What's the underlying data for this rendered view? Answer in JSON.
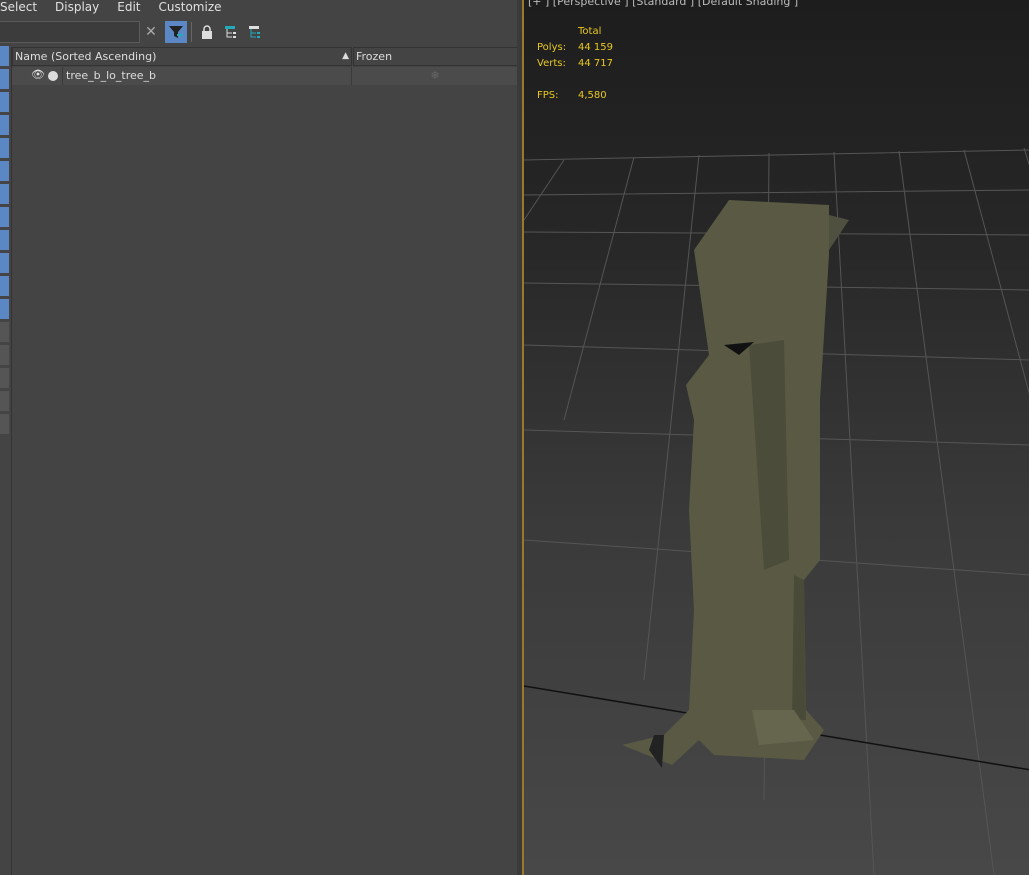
{
  "menu": [
    "Select",
    "Display",
    "Edit",
    "Customize"
  ],
  "search": {
    "value": "",
    "placeholder": ""
  },
  "toolbar": {
    "clear_icon": "close-icon",
    "filter_icon": "filter-icon",
    "lock_icon": "lock-icon",
    "hier1_icon": "hierarchy-icon",
    "hier2_icon": "hierarchy-icon"
  },
  "table": {
    "columns": [
      "Name (Sorted Ascending)",
      "Frozen"
    ],
    "sort_glyph": "▲",
    "rows": [
      {
        "name": "tree_b_lo_tree_b",
        "frozen_glyph": "❄"
      }
    ]
  },
  "viewport": {
    "label": "[+ ] [Perspective ] [Standard ] [Default Shading ]",
    "stats": {
      "header": "Total",
      "polys_label": "Polys:",
      "polys": "44 159",
      "verts_label": "Verts:",
      "verts": "44 717",
      "fps_label": "FPS:",
      "fps": "4,580"
    }
  },
  "colors": {
    "accent": "#5b87c5",
    "stats": "#e8c820",
    "viewport_border": "#9a7a2a",
    "mesh": "#5a5a44"
  }
}
